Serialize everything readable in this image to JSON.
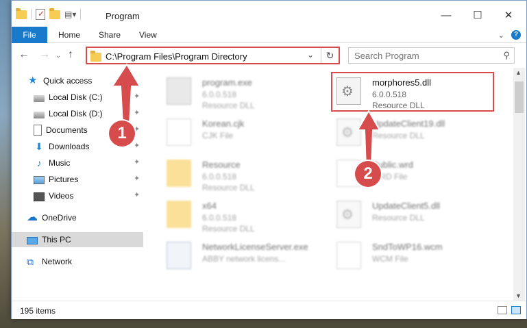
{
  "window": {
    "title": "Program"
  },
  "ribbon": {
    "tabs": [
      "File",
      "Home",
      "Share",
      "View"
    ]
  },
  "nav": {
    "address": "C:\\Program Files\\Program Directory",
    "search_placeholder": "Search Program"
  },
  "sidebar": {
    "items": [
      {
        "label": "Quick access",
        "icon": "star-icon",
        "pinned": false
      },
      {
        "label": "Local Disk (C:)",
        "icon": "drive-icon",
        "pinned": true
      },
      {
        "label": "Local Disk (D:)",
        "icon": "drive-icon",
        "pinned": true
      },
      {
        "label": "Documents",
        "icon": "document-icon",
        "pinned": true
      },
      {
        "label": "Downloads",
        "icon": "download-icon",
        "pinned": true
      },
      {
        "label": "Music",
        "icon": "music-icon",
        "pinned": true
      },
      {
        "label": "Pictures",
        "icon": "pictures-icon",
        "pinned": true
      },
      {
        "label": "Videos",
        "icon": "videos-icon",
        "pinned": true
      },
      {
        "label": "OneDrive",
        "icon": "cloud-icon",
        "pinned": false
      },
      {
        "label": "This PC",
        "icon": "computer-icon",
        "pinned": false,
        "selected": true
      },
      {
        "label": "Network",
        "icon": "network-icon",
        "pinned": false
      }
    ]
  },
  "files": [
    {
      "name": "program.exe",
      "line1": "6.0.0.518",
      "line2": "Resource DLL",
      "icon": "exe-icon",
      "highlighted": false
    },
    {
      "name": "morphores5.dll",
      "line1": "6.0.0.518",
      "line2": "Resource DLL",
      "icon": "dll-icon",
      "highlighted": true
    },
    {
      "name": "Korean.cjk",
      "line1": "CJK File",
      "line2": "",
      "icon": "file-icon",
      "highlighted": false
    },
    {
      "name": "UpdateClient19.dll",
      "line1": "Resource DLL",
      "line2": "",
      "icon": "dll-icon",
      "highlighted": false
    },
    {
      "name": "Resource",
      "line1": "6.0.0.518",
      "line2": "Resource DLL",
      "icon": "folder-icon",
      "highlighted": false
    },
    {
      "name": "Public.wrd",
      "line1": "WRD File",
      "line2": "",
      "icon": "file-icon",
      "highlighted": false
    },
    {
      "name": "x64",
      "line1": "6.0.0.518",
      "line2": "Resource DLL",
      "icon": "folder-icon",
      "highlighted": false
    },
    {
      "name": "UpdateClient5.dll",
      "line1": "Resource DLL",
      "line2": "",
      "icon": "dll-icon",
      "highlighted": false
    },
    {
      "name": "NetworkLicenseServer.exe",
      "line1": "ABBY network licens...",
      "line2": "",
      "icon": "window-icon",
      "highlighted": false
    },
    {
      "name": "SndToWP16.wcm",
      "line1": "WCM File",
      "line2": "",
      "icon": "file-icon",
      "highlighted": false
    }
  ],
  "status": {
    "item_count": "195 items"
  },
  "annotations": {
    "step1": "1",
    "step2": "2",
    "color": "#d64b4b"
  }
}
